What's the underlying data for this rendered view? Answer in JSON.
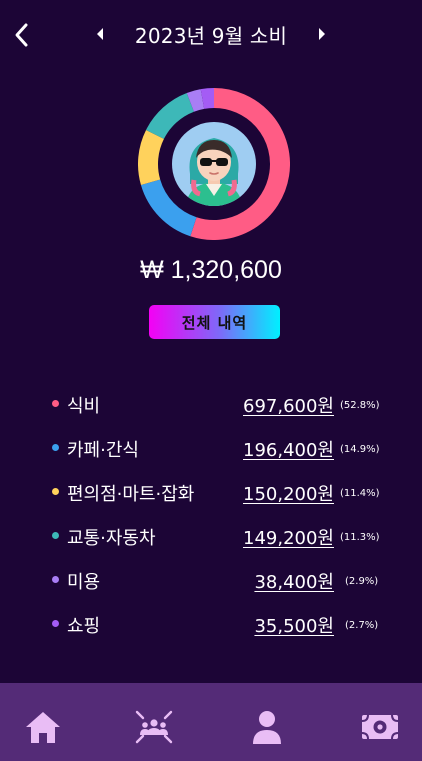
{
  "header": {
    "title": "2023년 9월 소비"
  },
  "total": "₩ 1,320,600",
  "detail_button": "전체 내역",
  "chart_data": {
    "type": "pie",
    "categories": [
      "식비",
      "카페·간식",
      "편의점·마트·잡화",
      "교통·자동차",
      "미용",
      "쇼핑"
    ],
    "values": [
      697600,
      196400,
      150200,
      149200,
      38400,
      35500
    ],
    "percents": [
      52.8,
      14.9,
      11.4,
      11.3,
      2.9,
      2.7
    ],
    "colors": [
      "#ff5c85",
      "#3ba0ee",
      "#ffd25c",
      "#3db8b8",
      "#a97ef5",
      "#a45cf5"
    ]
  },
  "categories": [
    {
      "name": "식비",
      "amount": "697,600원",
      "percent": "(52.8%)",
      "color": "#ff5c85"
    },
    {
      "name": "카페·간식",
      "amount": "196,400원",
      "percent": "(14.9%)",
      "color": "#3ba0ee"
    },
    {
      "name": "편의점·마트·잡화",
      "amount": "150,200원",
      "percent": "(11.4%)",
      "color": "#ffd25c"
    },
    {
      "name": "교통·자동차",
      "amount": "149,200원",
      "percent": "(11.3%)",
      "color": "#3db8b8"
    },
    {
      "name": "미용",
      "amount": "38,400원",
      "percent": "(2.9%)",
      "color": "#a97ef5"
    },
    {
      "name": "쇼핑",
      "amount": "35,500원",
      "percent": "(2.7%)",
      "color": "#a45cf5"
    }
  ],
  "icons": {
    "back": "chevron-left-icon",
    "prev": "triangle-left-icon",
    "next": "triangle-right-icon",
    "nav": [
      "home-icon",
      "group-icon",
      "user-icon",
      "money-icon"
    ]
  },
  "nav_icon_color": "#e9bdf5"
}
